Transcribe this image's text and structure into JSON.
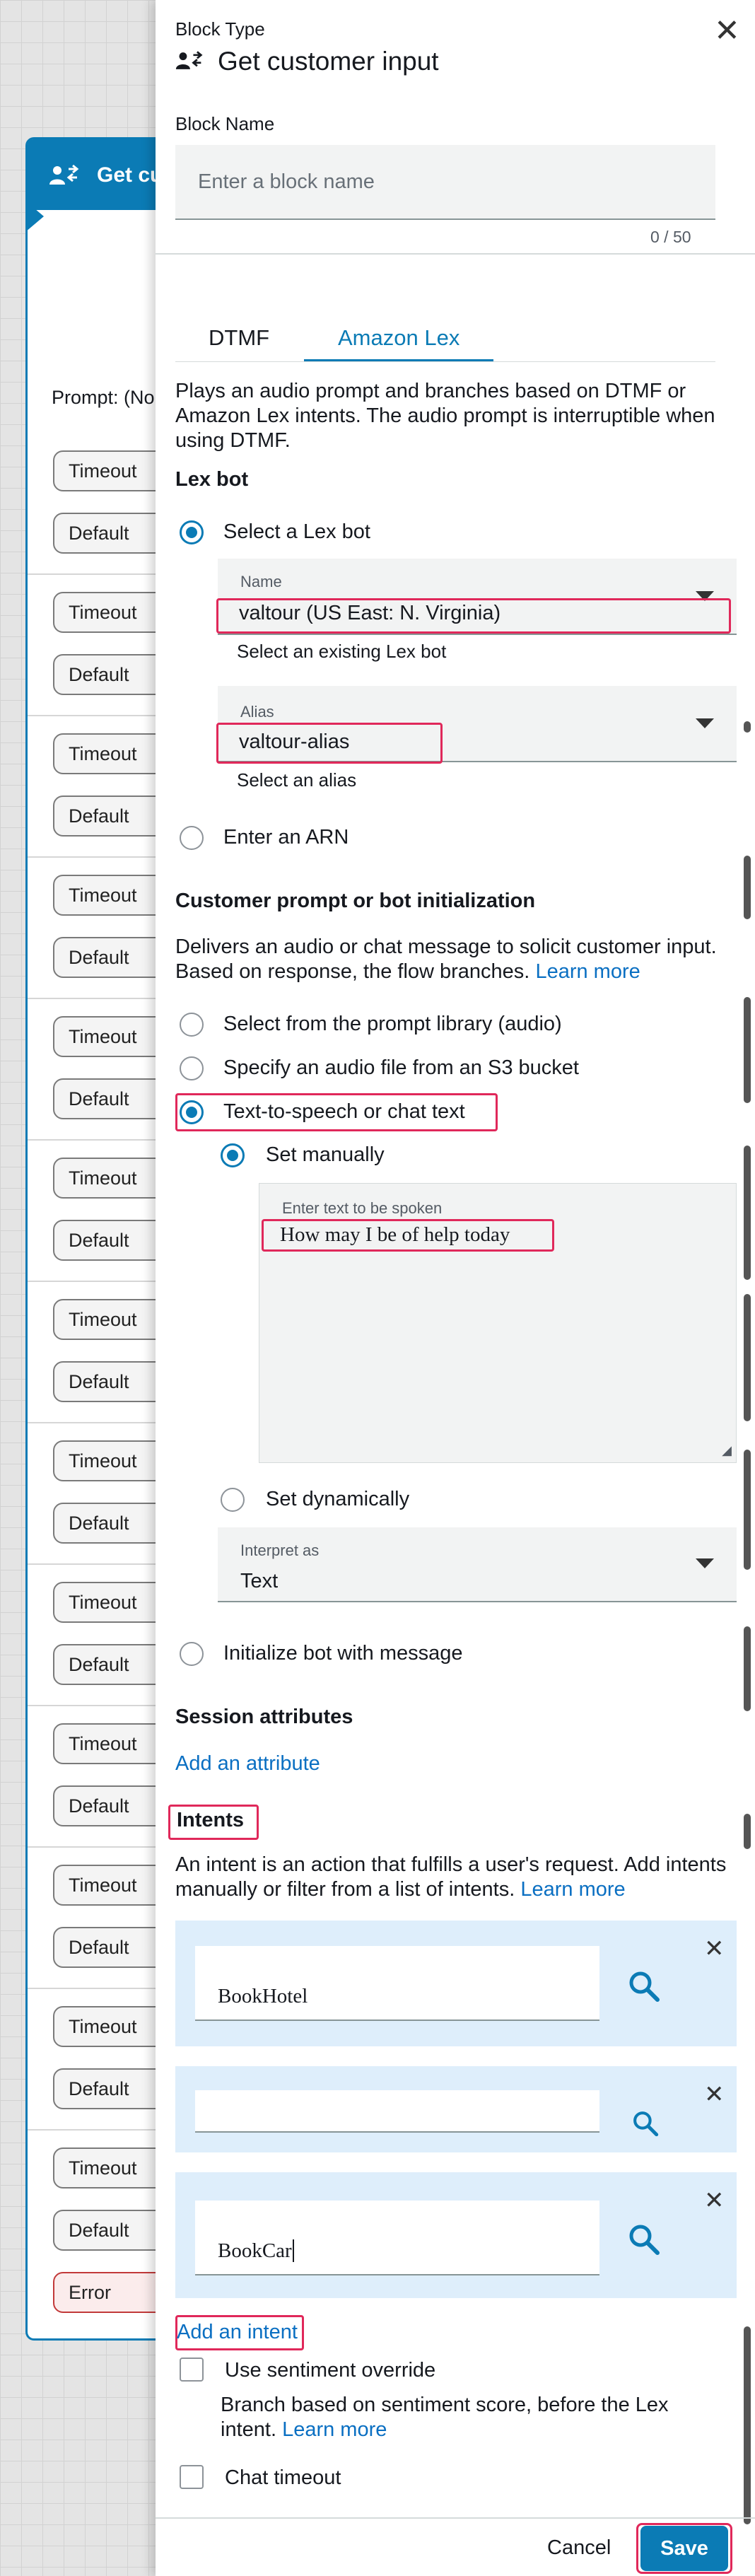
{
  "flow_block": {
    "title": "Get cu",
    "prompt": "Prompt: (No",
    "branches": [
      "Timeout",
      "Default",
      "Timeout",
      "Default",
      "Timeout",
      "Default",
      "Timeout",
      "Default",
      "Timeout",
      "Default",
      "Timeout",
      "Default",
      "Timeout",
      "Default",
      "Timeout",
      "Default",
      "Timeout",
      "Default",
      "Timeout",
      "Default",
      "Timeout",
      "Default",
      "Timeout",
      "Default",
      "Timeout",
      "Default"
    ],
    "error_label": "Error"
  },
  "panel": {
    "block_type_label": "Block Type",
    "block_type": "Get customer input",
    "block_name_label": "Block Name",
    "block_name_placeholder": "Enter a block name",
    "block_name_counter": "0 / 50",
    "tabs": {
      "dtmf": "DTMF",
      "lex": "Amazon Lex"
    },
    "description": "Plays an audio prompt and branches based on DTMF or Amazon Lex intents. The audio prompt is interruptible when using DTMF.",
    "lex_bot_heading": "Lex bot",
    "select_lex_bot": "Select a Lex bot",
    "name_label": "Name",
    "name_value": "valtour (US East: N. Virginia)",
    "name_hint": "Select an existing Lex bot",
    "alias_label": "Alias",
    "alias_value": "valtour-alias",
    "alias_hint": "Select an alias",
    "enter_arn": "Enter an ARN",
    "prompt_heading": "Customer prompt or bot initialization",
    "prompt_desc": "Delivers an audio or chat message to solicit customer input. Based on response, the flow branches.",
    "learn_more": "Learn more",
    "opt_library": "Select from the prompt library (audio)",
    "opt_s3": "Specify an audio file from an S3 bucket",
    "opt_tts": "Text-to-speech or chat text",
    "set_manually": "Set manually",
    "tts_label": "Enter text to be spoken",
    "tts_value": "How may I be of help today",
    "set_dynamically": "Set dynamically",
    "interpret_label": "Interpret as",
    "interpret_value": "Text",
    "init_bot": "Initialize bot with message",
    "session_heading": "Session attributes",
    "add_attribute": "Add an attribute",
    "intents_heading": "Intents",
    "intents_desc": "An intent is an action that fulfills a user's request. Add intents manually or filter from a list of intents.",
    "intents": [
      "BookHotel",
      "",
      "BookCar"
    ],
    "add_intent": "Add an intent",
    "sentiment_override": "Use sentiment override",
    "sentiment_desc": "Branch based on sentiment score, before the Lex intent.",
    "chat_timeout": "Chat timeout",
    "cancel": "Cancel",
    "save": "Save"
  },
  "colors": {
    "accent": "#0b7bb5",
    "highlight": "#e0285a",
    "link": "#0a6fc2",
    "intent_card_bg": "#deeefb"
  },
  "icons": [
    "close-icon",
    "customer-input-icon",
    "search-icon",
    "chevron-down-icon"
  ]
}
